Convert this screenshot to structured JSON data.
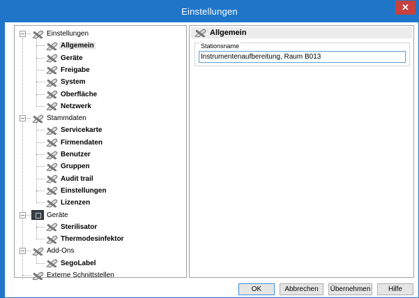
{
  "window": {
    "title": "Einstellungen",
    "close_glyph": "✕"
  },
  "tree": {
    "items": [
      {
        "label": "Einstellungen",
        "level": 0,
        "expander": "−",
        "icon": "tools-icon"
      },
      {
        "label": "Allgemein",
        "level": 1,
        "icon": "tools-icon",
        "selected": true
      },
      {
        "label": "Geräte",
        "level": 1,
        "icon": "tools-icon"
      },
      {
        "label": "Freigabe",
        "level": 1,
        "icon": "tools-icon"
      },
      {
        "label": "System",
        "level": 1,
        "icon": "tools-icon"
      },
      {
        "label": "Oberfläche",
        "level": 1,
        "icon": "tools-icon"
      },
      {
        "label": "Netzwerk",
        "level": 1,
        "icon": "tools-icon"
      },
      {
        "label": "Stammdaten",
        "level": 0,
        "expander": "−",
        "icon": "tools-icon"
      },
      {
        "label": "Servicekarte",
        "level": 1,
        "icon": "tools-icon"
      },
      {
        "label": "Firmendaten",
        "level": 1,
        "icon": "tools-icon"
      },
      {
        "label": "Benutzer",
        "level": 1,
        "icon": "tools-icon"
      },
      {
        "label": "Gruppen",
        "level": 1,
        "icon": "tools-icon"
      },
      {
        "label": "Audit trail",
        "level": 1,
        "icon": "tools-icon"
      },
      {
        "label": "Einstellungen",
        "level": 1,
        "icon": "tools-icon"
      },
      {
        "label": "Lizenzen",
        "level": 1,
        "icon": "tools-icon"
      },
      {
        "label": "Geräte",
        "level": 0,
        "expander": "−",
        "icon": "device-icon"
      },
      {
        "label": "Sterilisator",
        "level": 1,
        "icon": "tools-icon"
      },
      {
        "label": "Thermodesinfektor",
        "level": 1,
        "icon": "tools-icon"
      },
      {
        "label": "Add-Ons",
        "level": 0,
        "expander": "−",
        "icon": "tools-icon"
      },
      {
        "label": "SegoLabel",
        "level": 1,
        "icon": "tools-icon"
      },
      {
        "label": "Externe Schnittstellen",
        "level": 0,
        "icon": "tools-icon"
      }
    ]
  },
  "section": {
    "title": "Allgemein",
    "icon": "tools-icon"
  },
  "stationsname": {
    "legend": "Stationsname",
    "value": "Instrumentenaufbereitung, Raum B013"
  },
  "buttons": {
    "ok": "OK",
    "cancel": "Abbrechen",
    "apply": "Übernehmen",
    "help": "Hilfe"
  },
  "colors": {
    "titlebar": "#1f76c9",
    "close": "#c7413e",
    "input_border": "#5c9fd6"
  }
}
